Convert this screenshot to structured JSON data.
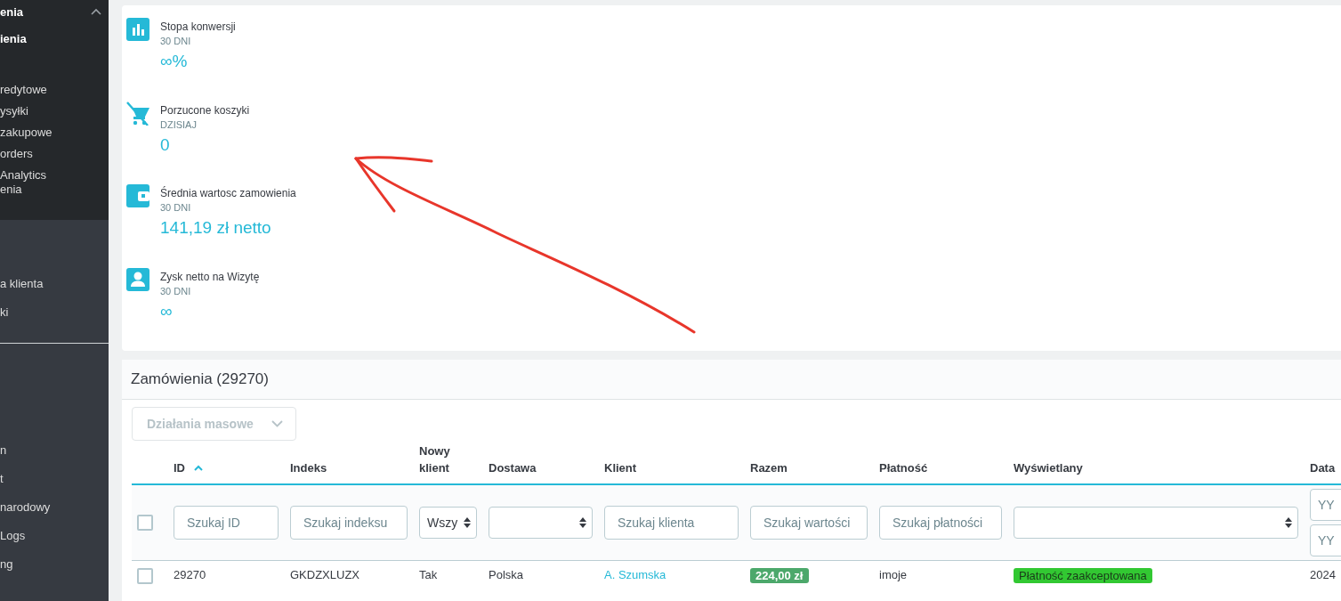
{
  "sidebar": {
    "sections": [
      {
        "kind": "dark",
        "items": [
          {
            "label": "enia",
            "kind": "header",
            "expanded": true
          },
          {
            "label": "ienia",
            "kind": "item",
            "selected": true
          },
          {
            "kind": "gap"
          },
          {
            "label": "redytowe",
            "kind": "item",
            "selected": false
          },
          {
            "label": "ysyłki",
            "kind": "item",
            "selected": false
          },
          {
            "label": "zakupowe",
            "kind": "item",
            "selected": false
          },
          {
            "label": "orders",
            "kind": "item",
            "selected": false
          },
          {
            "label": "Analytics\nenia",
            "kind": "item",
            "selected": false
          }
        ]
      },
      {
        "kind": "gray",
        "items": [
          {
            "kind": "gap"
          },
          {
            "label": "a klienta",
            "kind": "item",
            "selected": false
          },
          {
            "label": "ki",
            "kind": "item",
            "selected": false
          }
        ]
      },
      {
        "kind": "gray",
        "items": [
          {
            "label": "n",
            "kind": "item",
            "selected": false
          },
          {
            "label": "t",
            "kind": "item",
            "selected": false
          },
          {
            "label": "narodowy",
            "kind": "item",
            "selected": false
          },
          {
            "label": "Logs",
            "kind": "item",
            "selected": false
          },
          {
            "label": "ng",
            "kind": "item",
            "selected": false
          }
        ]
      }
    ]
  },
  "kpis": [
    {
      "kind": "chart",
      "title": "Stopa konwersji",
      "period": "30 DNI",
      "value": "∞%"
    },
    {
      "kind": "cart",
      "title": "Porzucone koszyki",
      "period": "DZISIAJ",
      "value": "0"
    },
    {
      "kind": "wallet",
      "title": "Średnia wartosc zamowienia",
      "period": "30 DNI",
      "value": "141,19 zł netto"
    },
    {
      "kind": "person",
      "title": "Zysk netto na Wizytę",
      "period": "30 DNI",
      "value": "∞"
    }
  ],
  "orders": {
    "title": "Zamówienia (29270)",
    "bulk_actions": "Działania masowe",
    "select_all_checked": false,
    "columns": [
      {
        "label": "ID",
        "sorted": true
      },
      {
        "label": "Indeks",
        "sorted": false
      },
      {
        "label": "Nowy klient",
        "sorted": false
      },
      {
        "label": "Dostawa",
        "sorted": false
      },
      {
        "label": "Klient",
        "sorted": false
      },
      {
        "label": "Razem",
        "sorted": false
      },
      {
        "label": "Płatność",
        "sorted": false
      },
      {
        "label": "Wyświetlany",
        "sorted": false
      },
      {
        "label": "Data",
        "sorted": false
      }
    ],
    "filters": [
      {
        "kind": "text",
        "placeholder": "Szukaj ID"
      },
      {
        "kind": "text",
        "placeholder": "Szukaj indeksu"
      },
      {
        "kind": "select",
        "value": "Wszy"
      },
      {
        "kind": "select"
      },
      {
        "kind": "text",
        "placeholder": "Szukaj klienta"
      },
      {
        "kind": "text",
        "placeholder": "Szukaj wartości"
      },
      {
        "kind": "text",
        "placeholder": "Szukaj płatności"
      },
      {
        "kind": "select"
      },
      {
        "kind": "dates",
        "placeholders": [
          "YY",
          "YY"
        ]
      }
    ],
    "rows": [
      {
        "checked": false,
        "id": "29270",
        "index": "GKDZXLUZX",
        "new_client": "Tak",
        "delivery": "Polska",
        "client": "A. Szumska",
        "total": "224,00 zł",
        "payment": "imoje",
        "status": {
          "label": "Płatność zaakceptowana",
          "color": "#32c832"
        },
        "date": "2024"
      }
    ]
  }
}
